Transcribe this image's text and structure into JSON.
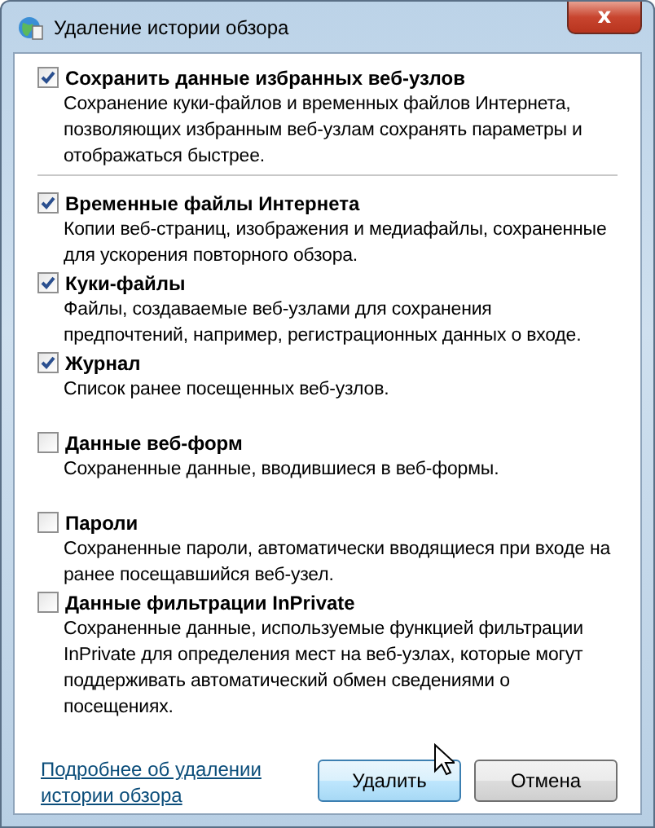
{
  "window": {
    "title": "Удаление истории обзора",
    "close": "x"
  },
  "options": [
    {
      "label": "Сохранить данные избранных веб-узлов",
      "checked": true,
      "description": "Сохранение куки-файлов и временных файлов Интернета, позволяющих избранным веб-узлам сохранять параметры и отображаться быстрее.",
      "separator_after": true
    },
    {
      "label": "Временные файлы Интернета",
      "checked": true,
      "description": "Копии веб-страниц, изображения и медиафайлы, сохраненные для ускорения повторного обзора."
    },
    {
      "label": "Куки-файлы",
      "checked": true,
      "description": "Файлы, создаваемые веб-узлами для сохранения предпочтений, например, регистрационных данных о входе."
    },
    {
      "label": "Журнал",
      "checked": true,
      "description": "Список ранее посещенных веб-узлов."
    },
    {
      "label": "Данные веб-форм",
      "checked": false,
      "description": "Сохраненные данные, вводившиеся в веб-формы."
    },
    {
      "label": "Пароли",
      "checked": false,
      "description": "Сохраненные пароли, автоматически вводящиеся при входе на ранее посещавшийся веб-узел."
    },
    {
      "label": "Данные фильтрации InPrivate",
      "checked": false,
      "description": "Сохраненные данные, используемые функцией фильтрации InPrivate для определения мест на веб-узлах, которые могут поддерживать автоматический обмен сведениями о посещениях."
    }
  ],
  "help_link": "Подробнее об удалении истории обзора",
  "buttons": [
    {
      "label": "Удалить",
      "focused": true
    },
    {
      "label": "Отмена",
      "focused": false
    }
  ]
}
